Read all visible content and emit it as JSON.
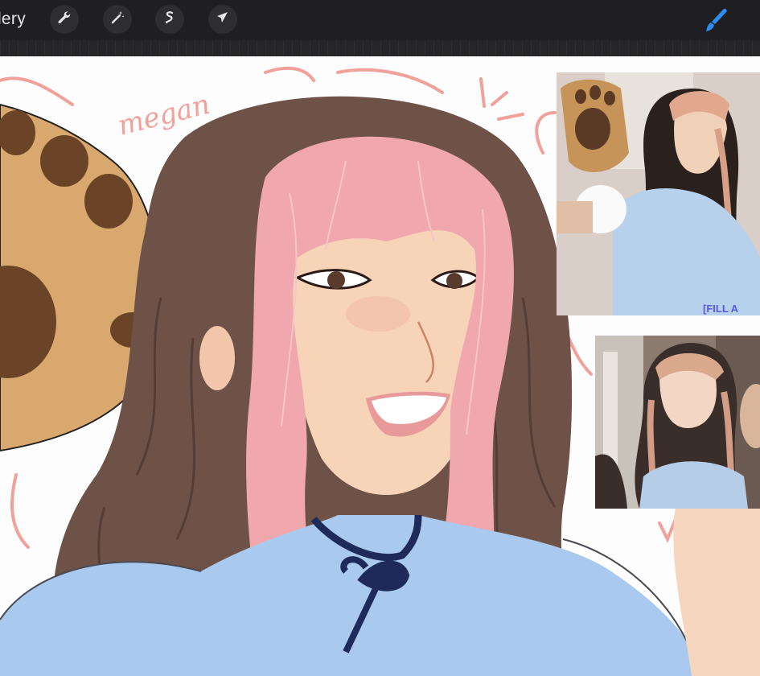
{
  "toolbar": {
    "gallery_label": "llery",
    "tools": [
      "wrench-icon",
      "magic-wand-icon",
      "selection-icon",
      "transform-arrow-icon"
    ],
    "active_tool": "brush-icon"
  },
  "colors": {
    "toolbar_bg": "#1f1f21",
    "accent_brush": "#2d8cf0",
    "sketch_pink": "#f2a09a"
  },
  "canvas": {
    "handwritten_text": "megan",
    "reference_caption": "[FILL A"
  }
}
